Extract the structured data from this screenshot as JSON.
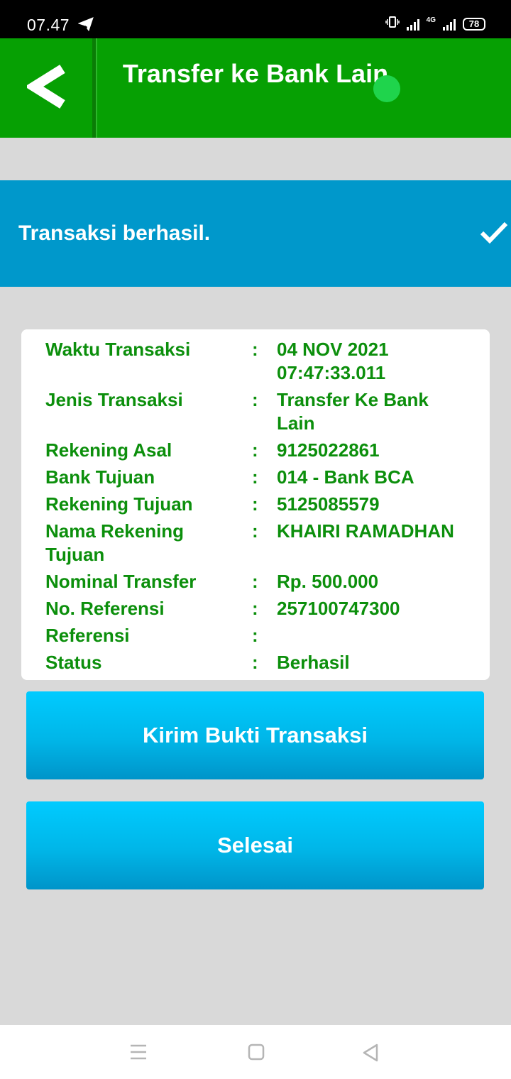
{
  "status_bar": {
    "time": "07.47",
    "battery": "78",
    "network": "4G"
  },
  "header": {
    "title": "Transfer ke Bank Lain",
    "accent_color": "#06a003",
    "back_icon": "chevron-left-icon"
  },
  "banner": {
    "message": "Transaksi berhasil.",
    "icon": "check-icon",
    "color": "#0098cb"
  },
  "details": [
    {
      "label": "Waktu Transaksi",
      "value": "04 NOV 2021 07:47:33.011"
    },
    {
      "label": "Jenis Transaksi",
      "value": "Transfer Ke Bank Lain"
    },
    {
      "label": "Rekening Asal",
      "value": "9125022861"
    },
    {
      "label": "Bank Tujuan",
      "value": "014 - Bank BCA"
    },
    {
      "label": "Rekening Tujuan",
      "value": "5125085579"
    },
    {
      "label": "Nama Rekening Tujuan",
      "value": "KHAIRI RAMADHAN"
    },
    {
      "label": "Nominal Transfer",
      "value": "Rp. 500.000"
    },
    {
      "label": "No. Referensi",
      "value": "257100747300"
    },
    {
      "label": "Referensi",
      "value": ""
    },
    {
      "label": "Status",
      "value": "Berhasil"
    }
  ],
  "separator": ":",
  "buttons": {
    "send_proof": "Kirim Bukti Transaksi",
    "done": "Selesai"
  },
  "nav": {
    "menu_icon": "menu-icon",
    "home_icon": "home-square-icon",
    "back_icon": "back-triangle-icon"
  }
}
